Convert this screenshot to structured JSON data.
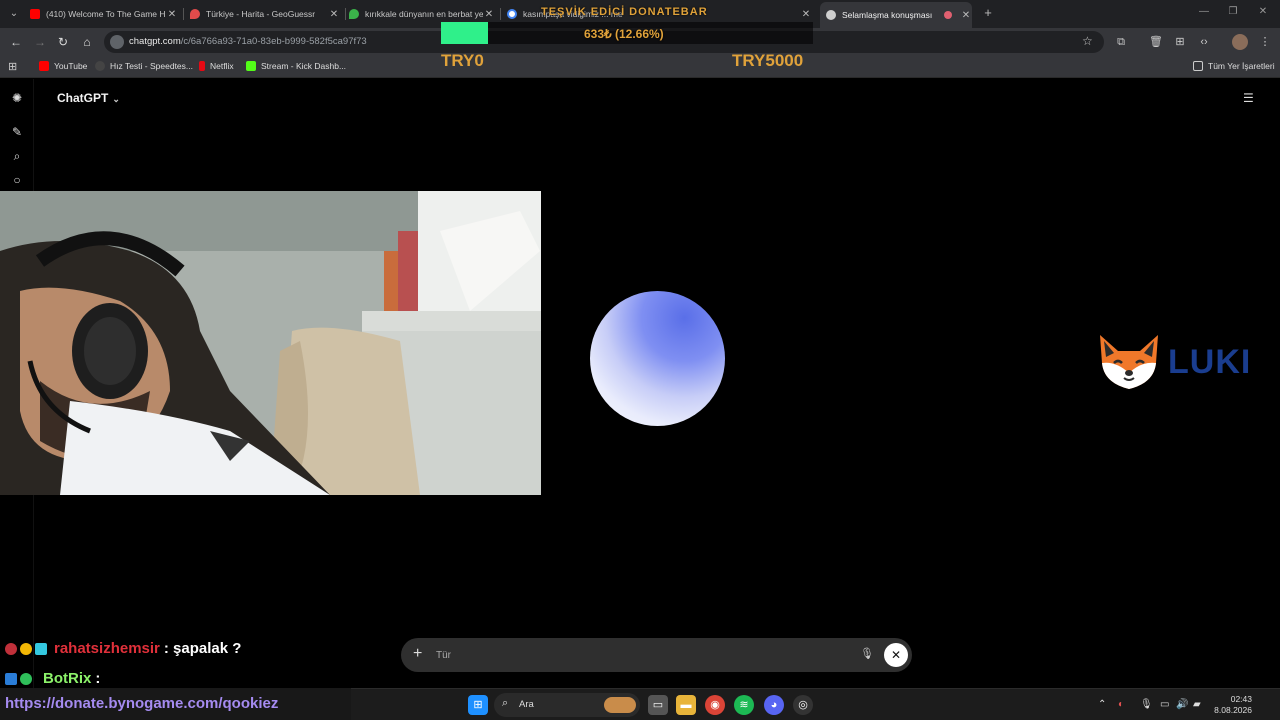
{
  "browser": {
    "tabs": [
      {
        "label": "(410) Welcome To The Game H",
        "favicon": "youtube-icon",
        "color": "#ff0000"
      },
      {
        "label": "Türkiye - Harita - GeoGuessr",
        "favicon": "map-pin-icon",
        "color": "#e24b4b"
      },
      {
        "label": "kırıkkale dünyanın en berbat ye",
        "favicon": "leaf-icon",
        "color": "#3bb34a"
      },
      {
        "label": "kasımpaşa vidigimiz ... me",
        "favicon": "google-icon",
        "color": "#4285f4"
      },
      {
        "label": "Selamlaşma konuşması",
        "favicon": "chatgpt-icon",
        "color": "#cfcfcf"
      }
    ],
    "url_host": "chatgpt.com",
    "url_path": "/c/6a766a93-71a0-83eb-b999-582f5ca97f73",
    "bookmarks": [
      {
        "label": "YouTube",
        "color": "#ff0000"
      },
      {
        "label": "Hız Testi - Speedtes...",
        "color": "#444444"
      },
      {
        "label": "Netflix",
        "color": "#e50914"
      },
      {
        "label": "Stream - Kick Dashb...",
        "color": "#53fc18"
      }
    ],
    "all_bookmarks_label": "Tüm Yer İşaretleri"
  },
  "overlay": {
    "goal_title": "TEŞVİK EDİCİ DONATEBAR",
    "goal_amount": "633₺ (12.66%)",
    "goal_progress": 0.1266,
    "goal_min": "TRY0",
    "goal_max": "TRY5000",
    "goal_fill_color": "#2ff08a",
    "goal_text_color": "#e0a23a"
  },
  "chatgpt": {
    "title": "ChatGPT",
    "composer_placeholder": "Tür",
    "logo_text": "LUKI"
  },
  "chat": {
    "lines": [
      {
        "user": "rahatsizhemsir",
        "message": ": şapalak ?"
      },
      {
        "user": "BotRix",
        "message": ":"
      }
    ],
    "donate_link": "https://donate.bynogame.com/qookiez"
  },
  "taskbar": {
    "search_label": "Ara",
    "time": "02:43",
    "date": "8.08.2026"
  }
}
